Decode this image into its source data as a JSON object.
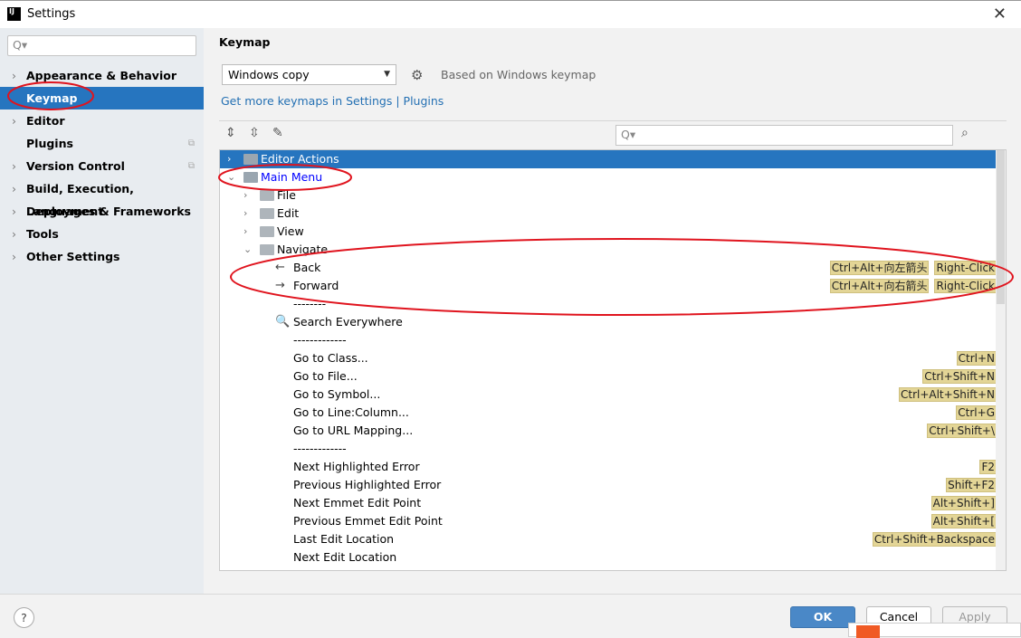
{
  "window": {
    "title": "Settings",
    "icon": "intellij-icon"
  },
  "sidebar": {
    "search_placeholder": "Q▾",
    "items": [
      {
        "label": "Appearance & Behavior",
        "expandable": true
      },
      {
        "label": "Keymap",
        "selected": true
      },
      {
        "label": "Editor",
        "expandable": true
      },
      {
        "label": "Plugins",
        "copy_icon": true
      },
      {
        "label": "Version Control",
        "expandable": true,
        "copy_icon": true
      },
      {
        "label": "Build, Execution, Deployment",
        "expandable": true
      },
      {
        "label": "Languages & Frameworks",
        "expandable": true
      },
      {
        "label": "Tools",
        "expandable": true
      },
      {
        "label": "Other Settings",
        "expandable": true
      }
    ]
  },
  "main": {
    "heading": "Keymap",
    "keymap_select": "Windows copy",
    "based_on": "Based on Windows keymap",
    "link": "Get more keymaps in Settings | Plugins",
    "filter_placeholder": "Q▾"
  },
  "tree": [
    {
      "label": "Editor Actions",
      "level": 0,
      "chev": ">",
      "selected": true
    },
    {
      "label": "Main Menu",
      "level": 0,
      "chev": "v"
    },
    {
      "label": "File",
      "level": 1,
      "chev": ">"
    },
    {
      "label": "Edit",
      "level": 1,
      "chev": ">"
    },
    {
      "label": "View",
      "level": 1,
      "chev": ">"
    },
    {
      "label": "Navigate",
      "level": 1,
      "chev": "v"
    },
    {
      "label": "Back",
      "level": 2,
      "icon": "←",
      "keys": [
        "Ctrl+Alt+向左箭头",
        "Right-Click"
      ]
    },
    {
      "label": "Forward",
      "level": 2,
      "icon": "→",
      "keys": [
        "Ctrl+Alt+向右箭头",
        "Right-Click"
      ]
    },
    {
      "label": "--------",
      "level": 2
    },
    {
      "label": "Search Everywhere",
      "level": 2,
      "icon": "🔍"
    },
    {
      "label": "-------------",
      "level": 2
    },
    {
      "label": "Go to Class...",
      "level": 2,
      "keys": [
        "Ctrl+N"
      ]
    },
    {
      "label": "Go to File...",
      "level": 2,
      "keys": [
        "Ctrl+Shift+N"
      ]
    },
    {
      "label": "Go to Symbol...",
      "level": 2,
      "keys": [
        "Ctrl+Alt+Shift+N"
      ]
    },
    {
      "label": "Go to Line:Column...",
      "level": 2,
      "keys": [
        "Ctrl+G"
      ]
    },
    {
      "label": "Go to URL Mapping...",
      "level": 2,
      "keys": [
        "Ctrl+Shift+\\"
      ]
    },
    {
      "label": "-------------",
      "level": 2
    },
    {
      "label": "Next Highlighted Error",
      "level": 2,
      "keys": [
        "F2"
      ]
    },
    {
      "label": "Previous Highlighted Error",
      "level": 2,
      "keys": [
        "Shift+F2"
      ]
    },
    {
      "label": "Next Emmet Edit Point",
      "level": 2,
      "keys": [
        "Alt+Shift+]"
      ]
    },
    {
      "label": "Previous Emmet Edit Point",
      "level": 2,
      "keys": [
        "Alt+Shift+["
      ]
    },
    {
      "label": "Last Edit Location",
      "level": 2,
      "keys": [
        "Ctrl+Shift+Backspace"
      ]
    },
    {
      "label": "Next Edit Location",
      "level": 2
    }
  ],
  "footer": {
    "help": "?",
    "ok": "OK",
    "cancel": "Cancel",
    "apply": "Apply"
  },
  "colors": {
    "selection": "#2675bf",
    "shortcut_bg": "#e3d596",
    "link": "#2470b3",
    "main_menu": "#0000ff",
    "annotation": "#e0141e"
  }
}
